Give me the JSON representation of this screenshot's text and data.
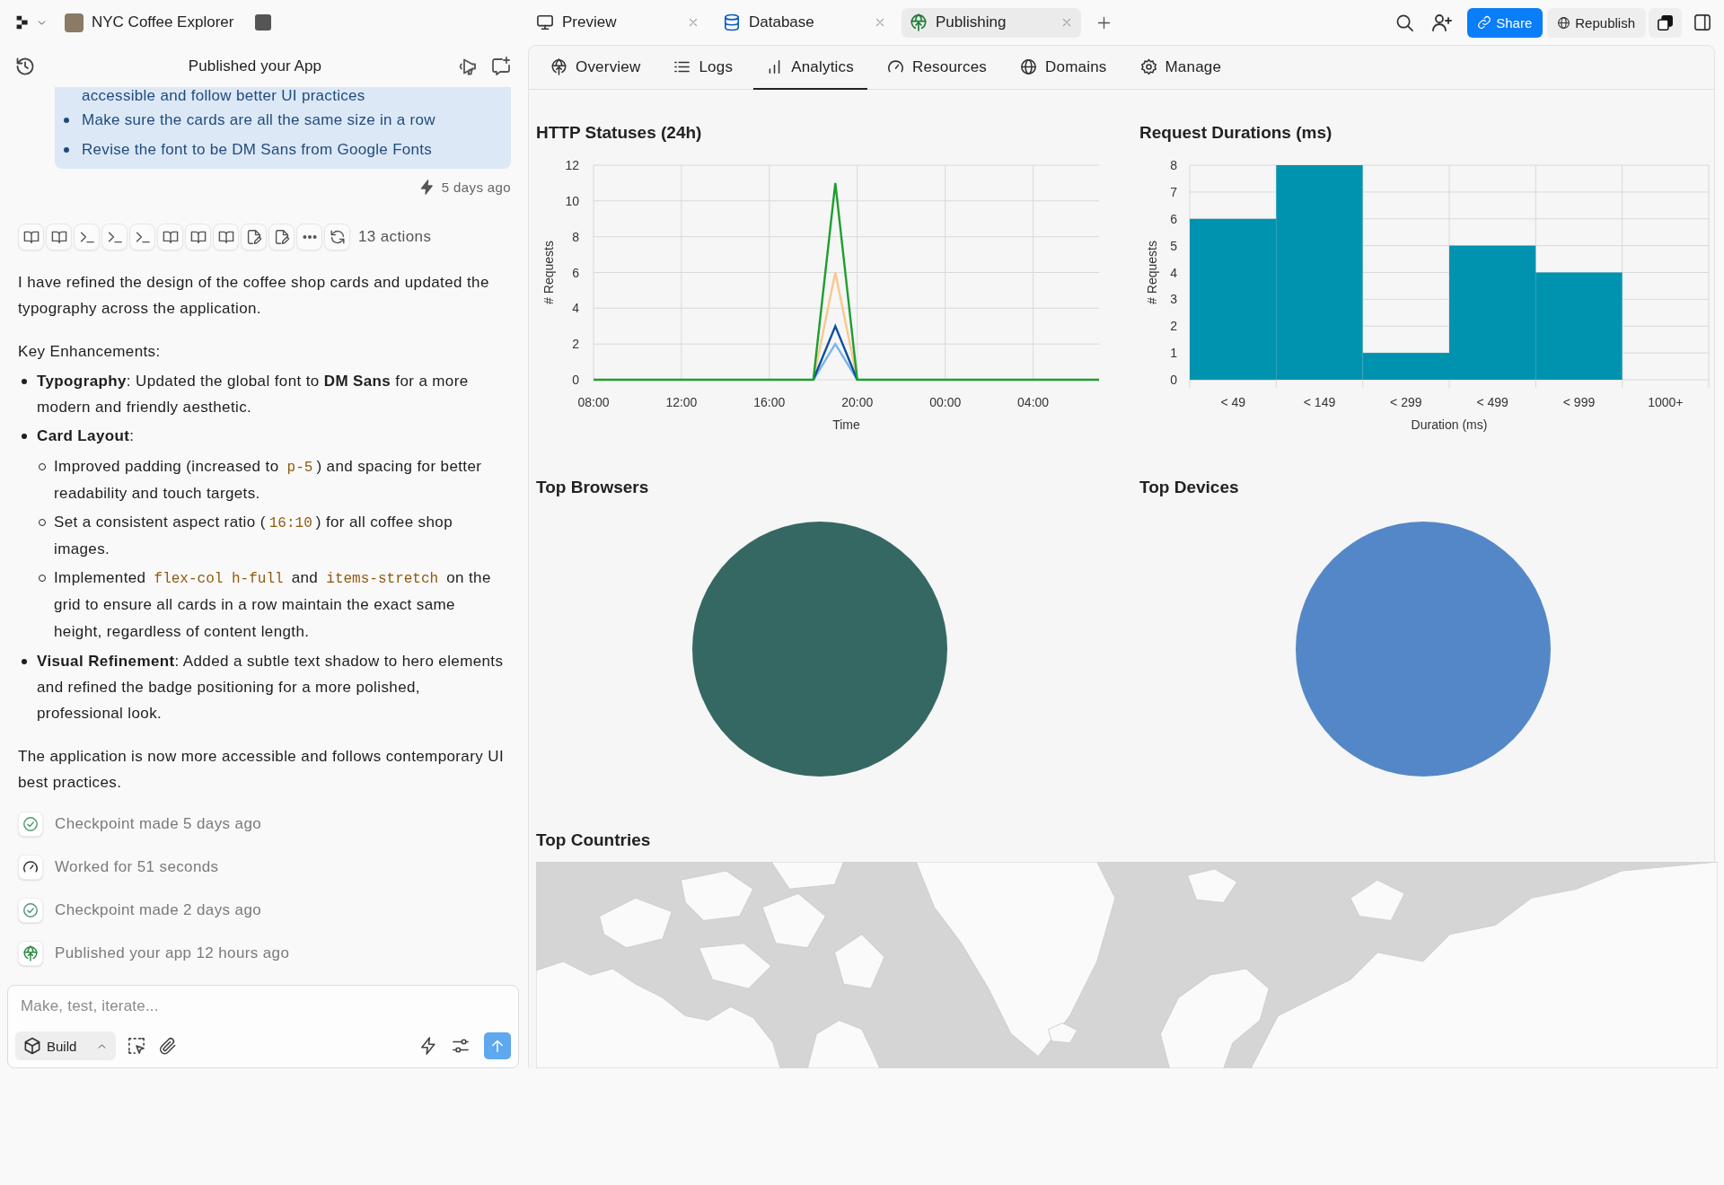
{
  "top_bar": {
    "project_name": "NYC Coffee Explorer",
    "tabs": [
      {
        "kind": "preview",
        "label": "Preview",
        "selected": false
      },
      {
        "kind": "database",
        "label": "Database",
        "selected": false
      },
      {
        "kind": "publishing",
        "label": "Publishing",
        "selected": true
      }
    ],
    "share_button": "Share",
    "republish_button": "Republish"
  },
  "chat": {
    "title": "Published your App",
    "bubble": {
      "cut_line": "accessible and follow better UI practices",
      "bullets": [
        "Make sure the cards are all the same size in a row",
        "Revise the font to be DM Sans from Google Fonts"
      ],
      "time": "5 days ago"
    },
    "actions": [
      {
        "kind": "read"
      },
      {
        "kind": "read"
      },
      {
        "kind": "shell"
      },
      {
        "kind": "shell"
      },
      {
        "kind": "shell"
      },
      {
        "kind": "read"
      },
      {
        "kind": "read"
      },
      {
        "kind": "read"
      },
      {
        "kind": "edit"
      },
      {
        "kind": "edit"
      },
      {
        "kind": "more"
      },
      {
        "kind": "retry"
      }
    ],
    "actions_count": "13 actions",
    "message": [
      {
        "kind": "paragraph",
        "segments": [
          {
            "kind": "text",
            "text": "I have refined the design of the coffee shop cards and updated the typography across the application."
          }
        ]
      },
      {
        "kind": "paragraph",
        "segments": [
          {
            "kind": "text",
            "text": "Key Enhancements:"
          }
        ]
      },
      {
        "kind": "list",
        "items": [
          {
            "segments": [
              {
                "kind": "text",
                "text": "**Typography**: Updated the global font to **DM Sans** for a more modern and friendly aesthetic."
              }
            ]
          },
          {
            "segments": [
              {
                "kind": "text",
                "text": "**Card Layout**:"
              }
            ],
            "children": [
              {
                "segments": [
                  {
                    "kind": "text",
                    "text": "Improved padding (increased to "
                  },
                  {
                    "kind": "code",
                    "text": "p-5"
                  },
                  {
                    "kind": "text",
                    "text": ") and spacing for better readability and touch targets."
                  }
                ]
              },
              {
                "segments": [
                  {
                    "kind": "text",
                    "text": "Set a consistent aspect ratio ("
                  },
                  {
                    "kind": "code",
                    "text": "16:10"
                  },
                  {
                    "kind": "text",
                    "text": ") for all coffee shop images."
                  }
                ]
              },
              {
                "segments": [
                  {
                    "kind": "text",
                    "text": "Implemented "
                  },
                  {
                    "kind": "code",
                    "text": "flex-col h-full"
                  },
                  {
                    "kind": "text",
                    "text": " and "
                  },
                  {
                    "kind": "code",
                    "text": "items-stretch"
                  },
                  {
                    "kind": "text",
                    "text": " on the grid to ensure all cards in a row maintain the exact same height, regardless of content length."
                  }
                ]
              }
            ]
          },
          {
            "segments": [
              {
                "kind": "text",
                "text": "**Visual Refinement**: Added a subtle text shadow to hero elements and refined the badge positioning for a more polished, professional look."
              }
            ]
          }
        ]
      },
      {
        "kind": "paragraph",
        "segments": [
          {
            "kind": "text",
            "text": "The application is now more accessible and follows contemporary UI best practices."
          }
        ]
      }
    ],
    "events": [
      {
        "kind": "checkpoint",
        "text": "Checkpoint made 5 days ago"
      },
      {
        "kind": "worked",
        "text": "Worked for 51 seconds"
      },
      {
        "kind": "checkpoint",
        "text": "Checkpoint made 2 days ago"
      },
      {
        "kind": "published",
        "text": "Published your app 12 hours ago"
      }
    ],
    "composer": {
      "placeholder": "Make, test, iterate...",
      "mode": "Build"
    }
  },
  "analytics": {
    "tabs": [
      {
        "kind": "overview",
        "label": "Overview",
        "selected": false
      },
      {
        "kind": "logs",
        "label": "Logs",
        "selected": false
      },
      {
        "kind": "analytics",
        "label": "Analytics",
        "selected": true
      },
      {
        "kind": "resources",
        "label": "Resources",
        "selected": false
      },
      {
        "kind": "domains",
        "label": "Domains",
        "selected": false
      },
      {
        "kind": "manage",
        "label": "Manage",
        "selected": false
      }
    ],
    "http_statuses": {
      "chart_data": {
        "type": "line",
        "title": "HTTP Statuses (24h)",
        "xlabel": "Time",
        "ylabel": "# Requests",
        "categories": [
          "08:00",
          null,
          null,
          null,
          "12:00",
          null,
          null,
          null,
          "16:00",
          null,
          null,
          null,
          "20:00",
          null,
          null,
          null,
          "00:00",
          null,
          null,
          null,
          "04:00",
          null,
          null,
          null
        ],
        "ylim": [
          0,
          12
        ],
        "yticks": [
          0,
          2,
          4,
          6,
          8,
          10,
          12
        ],
        "grid": true,
        "series": [
          {
            "color": "#f9c88f",
            "values": [
              null,
              null,
              null,
              null,
              null,
              null,
              null,
              null,
              null,
              null,
              0,
              6,
              0,
              null,
              null,
              null,
              null,
              null,
              null,
              null,
              null,
              null,
              null,
              null
            ]
          },
          {
            "color": "#7ab3ea",
            "values": [
              null,
              null,
              null,
              null,
              null,
              null,
              null,
              null,
              null,
              null,
              0,
              2,
              0,
              null,
              null,
              null,
              null,
              null,
              null,
              null,
              null,
              null,
              null,
              null
            ]
          },
          {
            "color": "#0b4f9e",
            "values": [
              null,
              null,
              null,
              null,
              null,
              null,
              null,
              null,
              null,
              null,
              0,
              3,
              0,
              null,
              null,
              null,
              null,
              null,
              null,
              null,
              null,
              null,
              null,
              null
            ]
          },
          {
            "color": "#1e9e2e",
            "values": [
              0,
              0,
              0,
              0,
              0,
              0,
              0,
              0,
              0,
              0,
              0,
              11,
              0,
              0,
              0,
              0,
              0,
              0,
              0,
              0,
              0,
              0,
              0,
              0
            ]
          }
        ]
      }
    },
    "request_durations": {
      "chart_data": {
        "type": "bar",
        "title": "Request Durations (ms)",
        "xlabel": "Duration (ms)",
        "ylabel": "# Requests",
        "categories": [
          "< 49",
          "< 149",
          "< 299",
          "< 499",
          "< 999",
          "1000+"
        ],
        "ylim": [
          0,
          8
        ],
        "yticks": [
          0,
          1,
          2,
          3,
          4,
          5,
          6,
          7,
          8
        ],
        "grid": true,
        "series": [
          {
            "color": "#0093b0",
            "values": [
              6,
              8,
              1,
              5,
              4,
              0
            ]
          }
        ]
      }
    },
    "top_browsers": {
      "title": "Top Browsers"
    },
    "top_devices": {
      "title": "Top Devices"
    },
    "top_countries": {
      "title": "Top Countries"
    }
  }
}
